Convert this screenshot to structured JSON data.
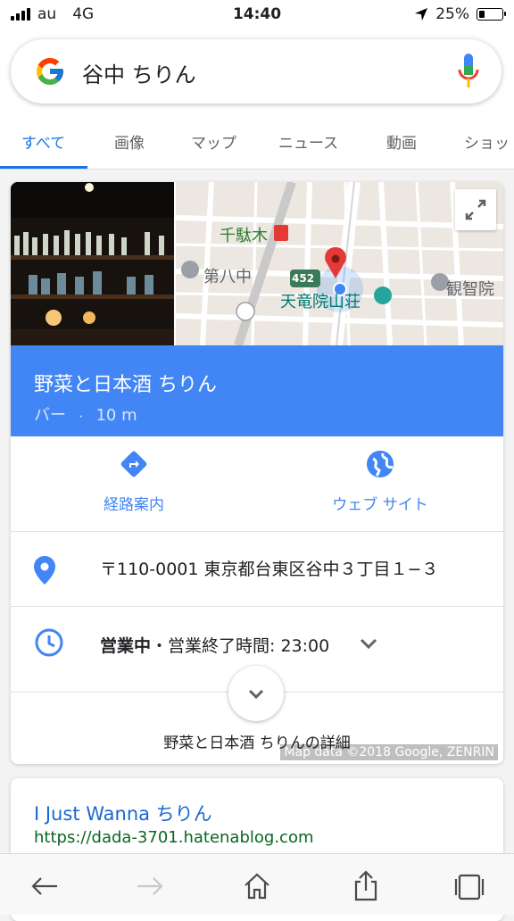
{
  "status": {
    "carrier": "au",
    "network": "4G",
    "time": "14:40",
    "battery": "25%",
    "battery_level": 0.25
  },
  "search": {
    "query": "谷中 ちりん"
  },
  "tabs": [
    {
      "label": "すべて",
      "active": true
    },
    {
      "label": "画像"
    },
    {
      "label": "マップ"
    },
    {
      "label": "ニュース"
    },
    {
      "label": "動画"
    },
    {
      "label": "ショッ"
    }
  ],
  "map": {
    "attribution": "Map data ©2018 Google, ZENRIN",
    "labels": {
      "station": "千駄木",
      "school": "第八中",
      "temple": "天竜院山荘",
      "temple2": "観智院",
      "route": "452"
    }
  },
  "place": {
    "name": "野菜と日本酒 ちりん",
    "category": "バー",
    "distance": "10 m"
  },
  "actions": {
    "directions": "経路案内",
    "website": "ウェブ サイト"
  },
  "address": "〒110-0001 東京都台東区谷中３丁目１−３",
  "hours": {
    "status": "営業中",
    "separator": "・",
    "close": "営業終了時間: 23:00"
  },
  "details_link": "野菜と日本酒 ちりんの詳細",
  "result2": {
    "title": "I Just Wanna ちりん",
    "url": "https://dada-3701.hatenablog.com"
  },
  "colors": {
    "accent": "#1a73e8",
    "header_blue": "#4285f4",
    "url_green": "#0b6623"
  }
}
